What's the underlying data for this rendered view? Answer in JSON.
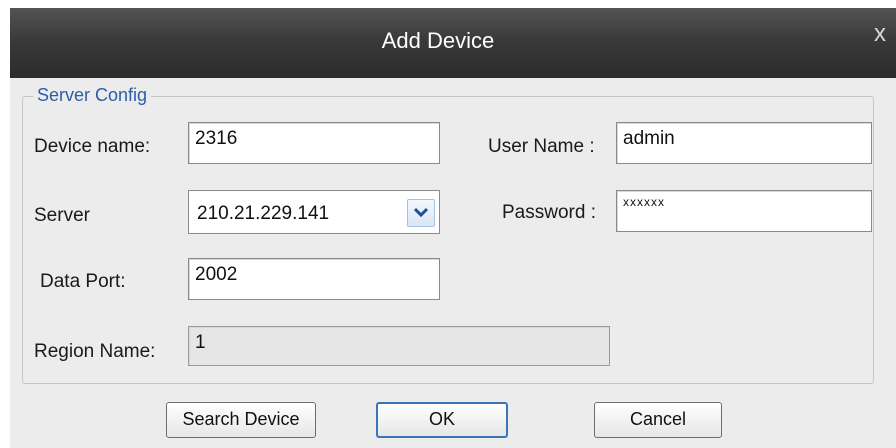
{
  "window": {
    "title": "Add Device",
    "close_glyph": "x"
  },
  "group": {
    "title": "Server Config"
  },
  "fields": {
    "device_name": {
      "label": "Device name:",
      "value": "2316"
    },
    "server": {
      "label": "Server",
      "value": "210.21.229.141"
    },
    "data_port": {
      "label": "Data Port:",
      "value": "2002"
    },
    "region_name": {
      "label": "Region Name:",
      "value": "1"
    },
    "user_name": {
      "label": "User Name :",
      "value": "admin"
    },
    "password": {
      "label": "Password :",
      "value": "xxxxxx"
    }
  },
  "buttons": {
    "search": "Search Device",
    "ok": "OK",
    "cancel": "Cancel"
  },
  "icons": {
    "dropdown": "chevron-down-icon",
    "close": "close-icon"
  },
  "colors": {
    "titlebar": "#3a3a3a",
    "group_title": "#2b5ea8",
    "focus_border": "#3c74b8"
  }
}
